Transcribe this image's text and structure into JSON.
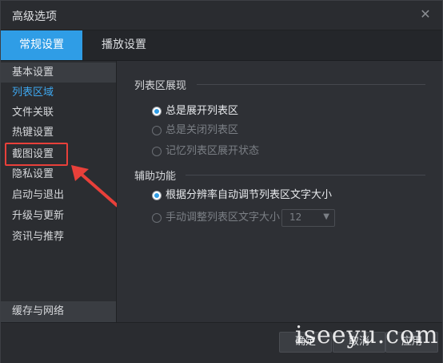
{
  "window": {
    "title": "高级选项",
    "close_icon": "close-icon"
  },
  "tabs": [
    {
      "label": "常规设置",
      "active": true
    },
    {
      "label": "播放设置",
      "active": false
    }
  ],
  "sidebar": {
    "items": [
      {
        "label": "基本设置"
      },
      {
        "label": "列表区域"
      },
      {
        "label": "文件关联"
      },
      {
        "label": "热键设置"
      },
      {
        "label": "截图设置"
      },
      {
        "label": "隐私设置"
      },
      {
        "label": "启动与退出"
      },
      {
        "label": "升级与更新"
      },
      {
        "label": "资讯与推荐"
      }
    ],
    "bottom": "缓存与网络"
  },
  "content": {
    "section1": {
      "title": "列表区展现",
      "options": [
        {
          "label": "总是展开列表区",
          "checked": true
        },
        {
          "label": "总是关闭列表区",
          "checked": false
        },
        {
          "label": "记忆列表区展开状态",
          "checked": false
        }
      ]
    },
    "section2": {
      "title": "辅助功能",
      "options": [
        {
          "label": "根据分辨率自动调节列表区文字大小",
          "checked": true
        },
        {
          "label": "手动调整列表区文字大小",
          "checked": false
        }
      ],
      "font_size": "12"
    }
  },
  "footer": {
    "ok": "确定",
    "cancel": "取消",
    "apply": "应用"
  },
  "watermark": "iseeyu.com",
  "colors": {
    "accent": "#2f9de6",
    "highlight": "#e8403a"
  }
}
